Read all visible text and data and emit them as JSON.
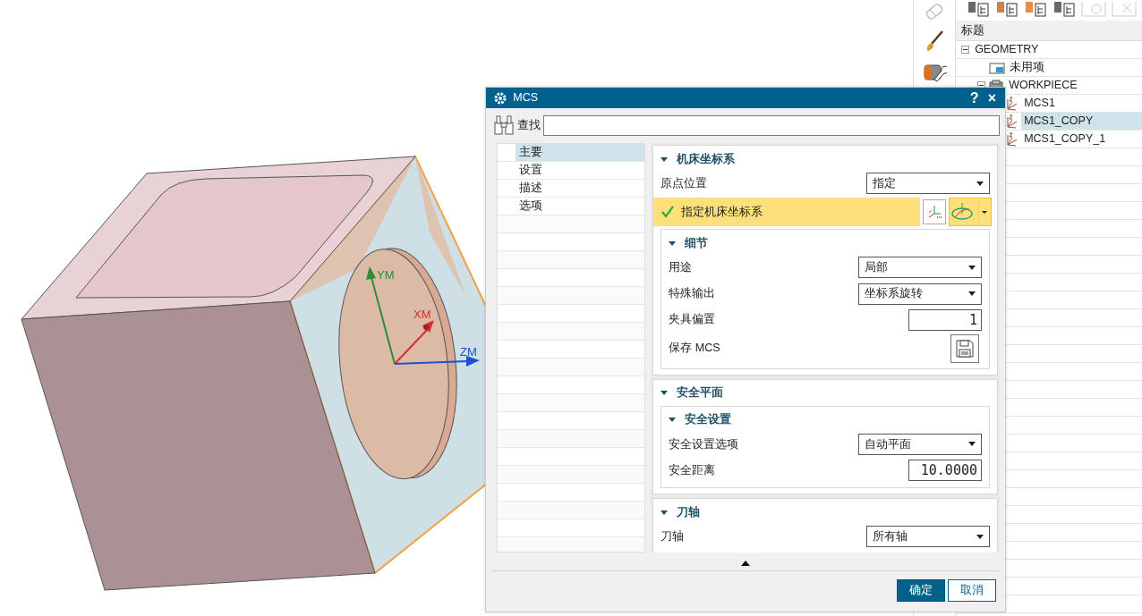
{
  "viewport": {
    "axes": [
      {
        "label": "YM",
        "color": "#2e8b3a"
      },
      {
        "label": "XM",
        "color": "#d03030"
      },
      {
        "label": "ZM",
        "color": "#1f50d0"
      }
    ]
  },
  "navigator": {
    "header": "标题",
    "tree": [
      {
        "label": "GEOMETRY",
        "expanded": true,
        "selected": false,
        "children": [
          {
            "label": "未用项",
            "selected": false,
            "kind": "folder"
          },
          {
            "label": "WORKPIECE",
            "expanded": true,
            "selected": false,
            "kind": "workpiece",
            "children": [
              {
                "label": "MCS1",
                "selected": false,
                "kind": "mcs"
              },
              {
                "label": "MCS1_COPY",
                "selected": true,
                "kind": "mcs"
              },
              {
                "label": "MCS1_COPY_1",
                "selected": false,
                "kind": "mcs"
              }
            ]
          }
        ]
      }
    ]
  },
  "dialog": {
    "title": "MCS",
    "title_buttons": [
      "?",
      "×"
    ],
    "search": {
      "label": "查找"
    },
    "categories": [
      {
        "label": "主要",
        "selected": true
      },
      {
        "label": "设置",
        "selected": false
      },
      {
        "label": "描述",
        "selected": false
      },
      {
        "label": "选项",
        "selected": false
      }
    ],
    "groups": [
      {
        "title": "机床坐标系",
        "expanded": true,
        "rows": [
          {
            "kind": "select",
            "label": "原点位置",
            "value": "指定"
          },
          {
            "kind": "specify",
            "label": "指定机床坐标系",
            "done": true
          },
          {
            "kind": "group",
            "title": "细节",
            "expanded": true,
            "rows": [
              {
                "kind": "select",
                "label": "用途",
                "value": "局部"
              },
              {
                "kind": "select",
                "label": "特殊输出",
                "value": "坐标系旋转"
              },
              {
                "kind": "number",
                "label": "夹具偏置",
                "value": "1"
              },
              {
                "kind": "save",
                "label": "保存 MCS"
              }
            ]
          }
        ]
      },
      {
        "title": "安全平面",
        "expanded": true,
        "rows": [
          {
            "kind": "group",
            "title": "安全设置",
            "expanded": true,
            "rows": [
              {
                "kind": "select",
                "label": "安全设置选项",
                "value": "自动平面"
              },
              {
                "kind": "number",
                "label": "安全距离",
                "value": "10.0000"
              }
            ]
          }
        ]
      },
      {
        "title": "刀轴",
        "expanded": true,
        "rows": [
          {
            "kind": "select",
            "label": "刀轴",
            "value": "所有轴"
          }
        ]
      }
    ],
    "buttons": [
      {
        "label": "确定",
        "kind": "primary"
      },
      {
        "label": "取消",
        "kind": "secondary"
      }
    ]
  }
}
